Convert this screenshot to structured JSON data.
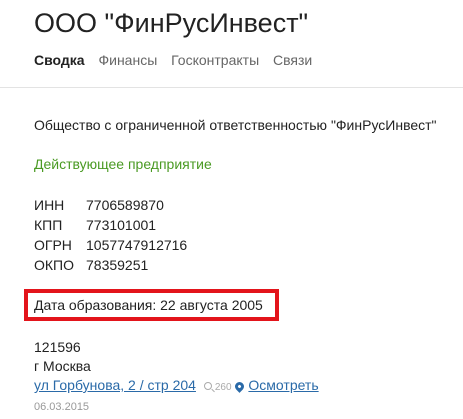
{
  "company": {
    "title": "ООО \"ФинРусИнвест\"",
    "full_name": "Общество с ограниченной ответственностью \"ФинРусИнвест\"",
    "status": "Действующее предприятие"
  },
  "tabs": [
    {
      "label": "Сводка",
      "active": true
    },
    {
      "label": "Финансы",
      "active": false
    },
    {
      "label": "Госконтракты",
      "active": false
    },
    {
      "label": "Связи",
      "active": false
    }
  ],
  "codes": [
    {
      "label": "ИНН",
      "value": "7706589870"
    },
    {
      "label": "КПП",
      "value": "773101001"
    },
    {
      "label": "ОГРН",
      "value": "1057747912716"
    },
    {
      "label": "ОКПО",
      "value": "78359251"
    }
  ],
  "founded": "Дата образования: 22 августа 2005",
  "address": {
    "postal_code": "121596",
    "city": "г Москва",
    "street": "ул Горбунова, 2 / стр 204",
    "views": "260",
    "map_link": "Осмотреть",
    "date": "06.03.2015"
  },
  "colors": {
    "status": "#4a9a23",
    "link": "#2a6aa8",
    "highlight": "#e3141b"
  },
  "icons": {
    "views": "magnifier-icon",
    "map": "map-pin-icon"
  }
}
